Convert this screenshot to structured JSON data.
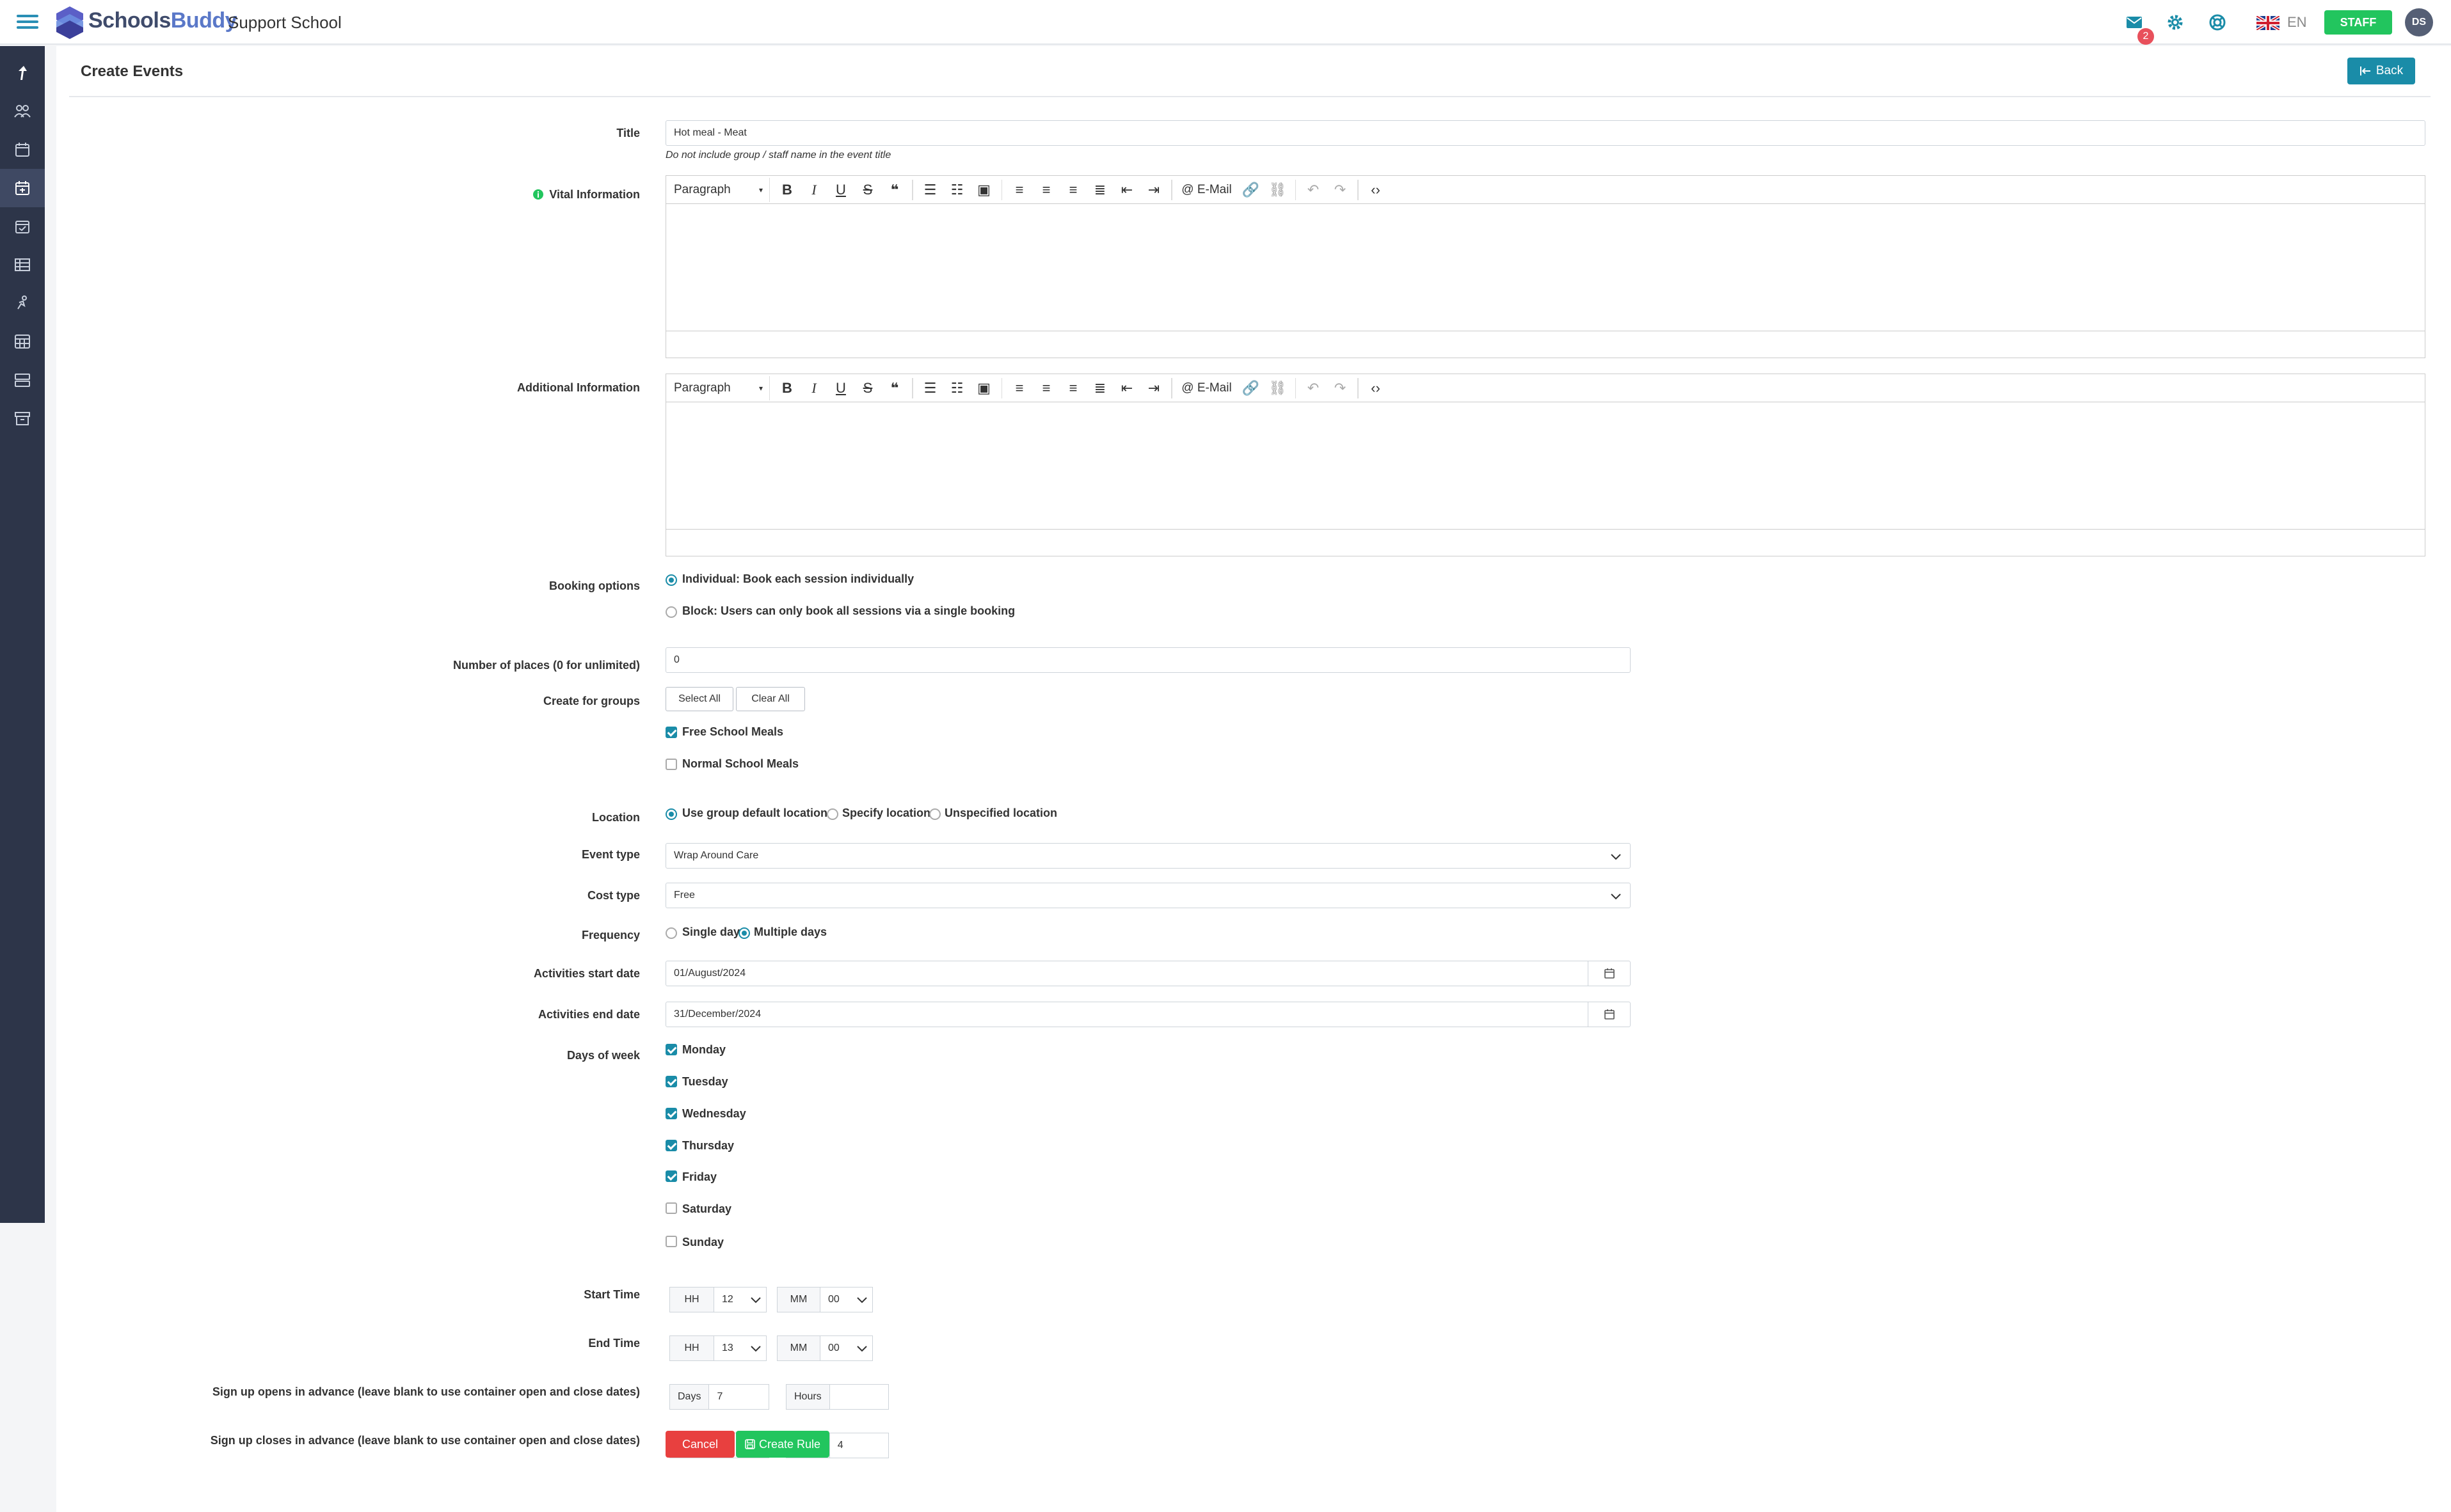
{
  "header": {
    "brand_part1": "Schools",
    "brand_part2": "Buddy",
    "school_name": "Support School",
    "notification_count": "2",
    "language": "EN",
    "role_badge": "STAFF",
    "avatar_initials": "DS",
    "accent_color": "#1a8ca8"
  },
  "page": {
    "title": "Create Events",
    "back_label": "Back"
  },
  "form": {
    "title_label": "Title",
    "title_value": "Hot meal - Meat",
    "title_hint": "Do not include group / staff name in the event title",
    "vital_label": "Vital Information",
    "additional_label": "Additional Information",
    "editor_format": "Paragraph",
    "editor_email": "E-Mail",
    "booking_label": "Booking options",
    "booking_individual": "Individual: Book each session individually",
    "booking_block": "Block: Users can only book all sessions via a single booking",
    "places_label": "Number of places (0 for unlimited)",
    "places_value": "0",
    "groups_label": "Create for groups",
    "select_all": "Select All",
    "clear_all": "Clear All",
    "group_free": "Free School Meals",
    "group_normal": "Normal School Meals",
    "location_label": "Location",
    "loc_default": "Use group default location",
    "loc_specify": "Specify location",
    "loc_unspecified": "Unspecified location",
    "event_type_label": "Event type",
    "event_type_value": "Wrap Around Care",
    "cost_type_label": "Cost type",
    "cost_type_value": "Free",
    "frequency_label": "Frequency",
    "freq_single": "Single day",
    "freq_multiple": "Multiple days",
    "start_date_label": "Activities start date",
    "start_date_value": "01/August/2024",
    "end_date_label": "Activities end date",
    "end_date_value": "31/December/2024",
    "days_label": "Days of week",
    "days": [
      "Monday",
      "Tuesday",
      "Wednesday",
      "Thursday",
      "Friday",
      "Saturday",
      "Sunday"
    ],
    "start_time_label": "Start Time",
    "end_time_label": "End Time",
    "hh": "HH",
    "mm": "MM",
    "start_hour": "12",
    "start_min": "00",
    "end_hour": "13",
    "end_min": "00",
    "signup_opens_label": "Sign up opens in advance (leave blank to use container open and close dates)",
    "signup_closes_label": "Sign up closes in advance (leave blank to use container open and close dates)",
    "days_addon": "Days",
    "hours_addon": "Hours",
    "opens_days": "7",
    "opens_hours": "",
    "closes_days": "",
    "closes_hours": "4",
    "cancel_label": "Cancel",
    "create_label": "Create Rule"
  }
}
